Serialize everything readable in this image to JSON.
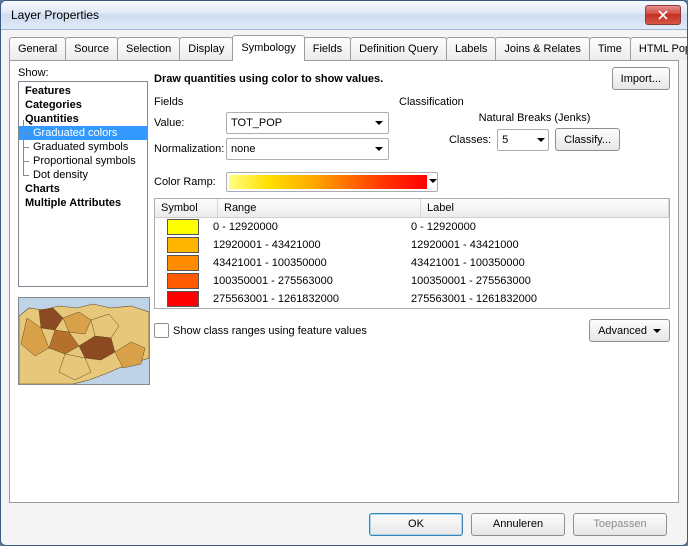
{
  "window": {
    "title": "Layer Properties"
  },
  "tabs": [
    "General",
    "Source",
    "Selection",
    "Display",
    "Symbology",
    "Fields",
    "Definition Query",
    "Labels",
    "Joins & Relates",
    "Time",
    "HTML Popup"
  ],
  "active_tab": "Symbology",
  "show_label": "Show:",
  "tree": {
    "features": "Features",
    "categories": "Categories",
    "quantities": "Quantities",
    "q_children": [
      "Graduated colors",
      "Graduated symbols",
      "Proportional symbols",
      "Dot density"
    ],
    "charts": "Charts",
    "multiple": "Multiple Attributes",
    "selected": "Graduated colors"
  },
  "heading": "Draw quantities using color to show values.",
  "import_btn": "Import...",
  "fields": {
    "group": "Fields",
    "value_label": "Value:",
    "value": "TOT_POP",
    "norm_label": "Normalization:",
    "norm": "none"
  },
  "classification": {
    "group": "Classification",
    "method": "Natural Breaks (Jenks)",
    "classes_label": "Classes:",
    "classes": "5",
    "classify_btn": "Classify..."
  },
  "ramp_label": "Color Ramp:",
  "grid": {
    "headers": {
      "symbol": "Symbol",
      "range": "Range",
      "label": "Label"
    },
    "rows": [
      {
        "color": "#ffff00",
        "range": "0 - 12920000",
        "label": "0 - 12920000"
      },
      {
        "color": "#ffb400",
        "range": "12920001 - 43421000",
        "label": "12920001 - 43421000"
      },
      {
        "color": "#ff8c00",
        "range": "43421001 - 100350000",
        "label": "43421001 - 100350000"
      },
      {
        "color": "#ff5a00",
        "range": "100350001 - 275563000",
        "label": "100350001 - 275563000"
      },
      {
        "color": "#ff0000",
        "range": "275563001 - 1261832000",
        "label": "275563001 - 1261832000"
      }
    ]
  },
  "show_ranges_label": "Show class ranges using feature values",
  "advanced_btn": "Advanced",
  "buttons": {
    "ok": "OK",
    "cancel": "Annuleren",
    "apply": "Toepassen"
  }
}
